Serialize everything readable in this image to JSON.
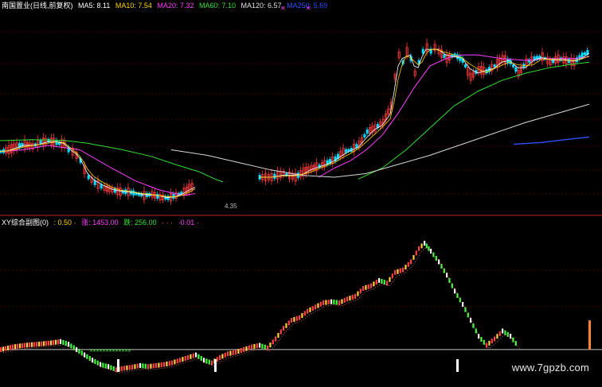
{
  "top_header": {
    "stock_title": "南国置业(日线,前复权)",
    "ma5": "MA5: 8.11",
    "ma10": "MA10: 7.54",
    "ma20": "MA20: 7.32",
    "ma60": "MA60: 7.10",
    "ma120": "MA120: 6.57",
    "ma250": "MA250: 5.69"
  },
  "sub_header": {
    "title": "XY综合副图(0)",
    "v1": ": 0.50 ·",
    "rise": "涨: 1453.00",
    "fall": "跌: 256.00",
    "dots": "·  ·  ·",
    "v2": "·0.01 ·"
  },
  "price_label": "4.35",
  "watermark": "www.7gpzb.com",
  "colors": {
    "background": "#000000",
    "grid": "#8b0000",
    "up_candle": "#ff3b3b",
    "down_candle": "#00d8ff",
    "ma5": "#ffffff",
    "ma10": "#ffd400",
    "ma20": "#ff40ff",
    "ma60": "#30e030",
    "ma120": "#d8d8d8",
    "ma250": "#3050ff",
    "osc_up": "#ff4040",
    "osc_down": "#40ff40",
    "osc_mid": "#ffd040"
  },
  "chart_data": [
    {
      "type": "line",
      "title": "南国置业(日线,前复权)",
      "note": "main candlestick panel with moving averages; y axis in price units",
      "ylim": [
        4.0,
        9.4
      ],
      "price_path_x": [
        0,
        10,
        20,
        30,
        40,
        50,
        60,
        70,
        80,
        85,
        90,
        95,
        100,
        105,
        110,
        118,
        130,
        140,
        150,
        160,
        170,
        180,
        190,
        200,
        210,
        220,
        230,
        240,
        245
      ],
      "price_path_y": [
        5.55,
        5.6,
        5.7,
        5.75,
        5.7,
        5.8,
        5.85,
        5.8,
        5.75,
        5.6,
        5.55,
        5.45,
        5.3,
        5.05,
        4.85,
        4.7,
        4.55,
        4.5,
        4.45,
        4.45,
        4.4,
        4.35,
        4.38,
        4.3,
        4.28,
        4.35,
        4.45,
        4.6,
        4.55
      ],
      "price_path2_x": [
        325,
        340,
        355,
        370,
        380,
        390,
        400,
        410,
        420,
        430,
        440,
        450,
        460,
        470,
        480,
        490,
        495,
        500,
        505,
        510,
        515,
        520,
        525,
        530,
        535,
        540,
        545,
        550,
        560,
        570,
        580,
        590,
        600,
        610,
        620,
        630,
        640,
        650,
        660,
        670,
        680,
        690,
        700,
        710,
        720,
        730,
        740
      ],
      "price_path2_y": [
        4.85,
        4.85,
        4.95,
        4.85,
        5.0,
        5.1,
        5.15,
        5.25,
        5.35,
        5.55,
        5.6,
        5.75,
        6.1,
        6.2,
        6.35,
        6.8,
        7.6,
        8.2,
        8.0,
        8.3,
        8.1,
        7.7,
        8.0,
        8.3,
        8.4,
        8.3,
        8.4,
        8.3,
        8.1,
        8.2,
        8.05,
        7.6,
        7.8,
        7.75,
        7.9,
        8.1,
        8.0,
        7.7,
        8.0,
        8.1,
        8.15,
        8.0,
        8.1,
        8.05,
        8.0,
        8.2,
        8.3
      ],
      "ma60_x": [
        0,
        40,
        80,
        110,
        150,
        190,
        220,
        250,
        270,
        280
      ],
      "ma60_y": [
        5.85,
        5.88,
        5.86,
        5.78,
        5.62,
        5.42,
        5.2,
        5.0,
        4.8,
        4.72
      ],
      "ma60b_x": [
        450,
        480,
        510,
        540,
        570,
        600,
        630,
        660,
        690,
        720,
        740
      ],
      "ma60b_y": [
        4.8,
        5.1,
        5.6,
        6.2,
        6.8,
        7.2,
        7.5,
        7.7,
        7.85,
        7.95,
        8.0
      ],
      "ma20_x": [
        0,
        30,
        60,
        100,
        140,
        170,
        200,
        230,
        245
      ],
      "ma20_y": [
        5.55,
        5.6,
        5.72,
        5.6,
        5.1,
        4.75,
        4.5,
        4.35,
        4.4
      ],
      "ma20b_x": [
        400,
        420,
        440,
        460,
        480,
        500,
        520,
        540,
        560,
        580,
        600,
        630,
        660,
        690,
        720,
        740
      ],
      "ma20b_y": [
        4.85,
        5.1,
        5.3,
        5.6,
        6.0,
        6.6,
        7.3,
        7.9,
        8.1,
        8.2,
        8.2,
        8.1,
        8.05,
        8.1,
        8.1,
        8.15
      ],
      "ma120_x": [
        215,
        260,
        300,
        340,
        380,
        420,
        460,
        500,
        540,
        580,
        620,
        660,
        700,
        740
      ],
      "ma120_y": [
        5.6,
        5.45,
        5.25,
        5.05,
        4.9,
        4.85,
        4.95,
        5.2,
        5.45,
        5.75,
        6.05,
        6.35,
        6.6,
        6.85
      ],
      "ma250_x": [
        645,
        680,
        710,
        740
      ],
      "ma250_y": [
        5.75,
        5.8,
        5.88,
        5.95
      ]
    },
    {
      "type": "line",
      "title": "XY综合副图(0)",
      "note": "oscillator panel; y axis in oscillator units",
      "ylim": [
        -45,
        230
      ],
      "baseline": 0,
      "x": [
        0,
        15,
        30,
        45,
        60,
        75,
        85,
        95,
        105,
        115,
        125,
        135,
        145,
        155,
        165,
        175,
        185,
        195,
        205,
        215,
        225,
        235,
        245,
        255,
        265,
        275,
        285,
        295,
        305,
        315,
        325,
        335,
        345,
        355,
        365,
        375,
        385,
        395,
        405,
        415,
        425,
        435,
        445,
        455,
        465,
        475,
        485,
        495,
        505,
        515,
        525,
        532,
        540,
        550,
        560,
        570,
        580,
        590,
        600,
        610,
        620,
        630,
        640,
        650
      ],
      "values": [
        0,
        5,
        8,
        10,
        12,
        15,
        10,
        0,
        -10,
        -20,
        -28,
        -32,
        -38,
        -35,
        -33,
        -30,
        -32,
        -30,
        -28,
        -25,
        -20,
        -15,
        -10,
        -20,
        -25,
        -15,
        -8,
        -5,
        0,
        5,
        8,
        3,
        20,
        40,
        55,
        60,
        72,
        80,
        88,
        90,
        88,
        95,
        100,
        115,
        120,
        130,
        125,
        145,
        150,
        165,
        190,
        200,
        185,
        165,
        140,
        110,
        85,
        55,
        25,
        8,
        20,
        35,
        25,
        5
      ],
      "tail_x": [
        740
      ],
      "tail_values": [
        55
      ]
    }
  ]
}
